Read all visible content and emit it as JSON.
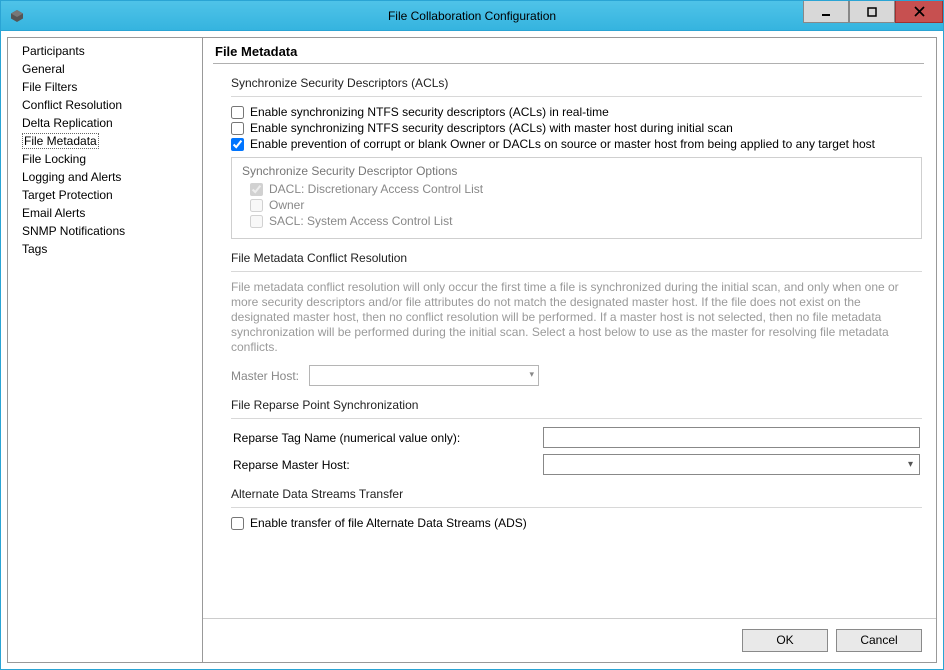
{
  "window": {
    "title": "File Collaboration Configuration"
  },
  "sidebar": {
    "items": [
      {
        "label": "Participants"
      },
      {
        "label": "General"
      },
      {
        "label": "File Filters"
      },
      {
        "label": "Conflict Resolution"
      },
      {
        "label": "Delta Replication"
      },
      {
        "label": "File Metadata",
        "selected": true
      },
      {
        "label": "File Locking"
      },
      {
        "label": "Logging and Alerts"
      },
      {
        "label": "Target Protection"
      },
      {
        "label": "Email Alerts"
      },
      {
        "label": "SNMP Notifications"
      },
      {
        "label": "Tags"
      }
    ]
  },
  "page": {
    "title": "File Metadata"
  },
  "acl": {
    "heading": "Synchronize Security Descriptors (ACLs)",
    "cb1": {
      "label": "Enable synchronizing NTFS security descriptors (ACLs) in real-time",
      "checked": false
    },
    "cb2": {
      "label": "Enable synchronizing NTFS security descriptors (ACLs) with master host during initial scan",
      "checked": false
    },
    "cb3": {
      "label": "Enable prevention of corrupt or blank Owner or DACLs on source or master host from being applied to any target host",
      "checked": true
    },
    "options_heading": "Synchronize Security Descriptor Options",
    "opt_dacl": {
      "label": "DACL: Discretionary Access Control List",
      "checked": true,
      "disabled": true
    },
    "opt_owner": {
      "label": "Owner",
      "checked": false,
      "disabled": true
    },
    "opt_sacl": {
      "label": "SACL: System Access Control List",
      "checked": false,
      "disabled": true
    }
  },
  "conflict": {
    "heading": "File Metadata Conflict Resolution",
    "desc": "File metadata conflict resolution will only occur the first time a file is synchronized during the initial scan, and only when one or more security descriptors and/or file attributes do not match the designated master host. If the file does not exist on the designated master host, then no conflict resolution will be performed. If a master host is not selected, then no file metadata synchronization will be performed during the initial scan. Select a host below to use as the master for resolving file metadata conflicts.",
    "master_host_label": "Master Host:",
    "master_host_value": ""
  },
  "reparse": {
    "heading": "File Reparse Point Synchronization",
    "tag_label": "Reparse Tag Name (numerical value only):",
    "tag_value": "",
    "host_label": "Reparse Master Host:",
    "host_value": ""
  },
  "ads": {
    "heading": "Alternate Data Streams Transfer",
    "cb": {
      "label": "Enable transfer of file Alternate Data Streams (ADS)",
      "checked": false
    }
  },
  "footer": {
    "ok": "OK",
    "cancel": "Cancel"
  }
}
